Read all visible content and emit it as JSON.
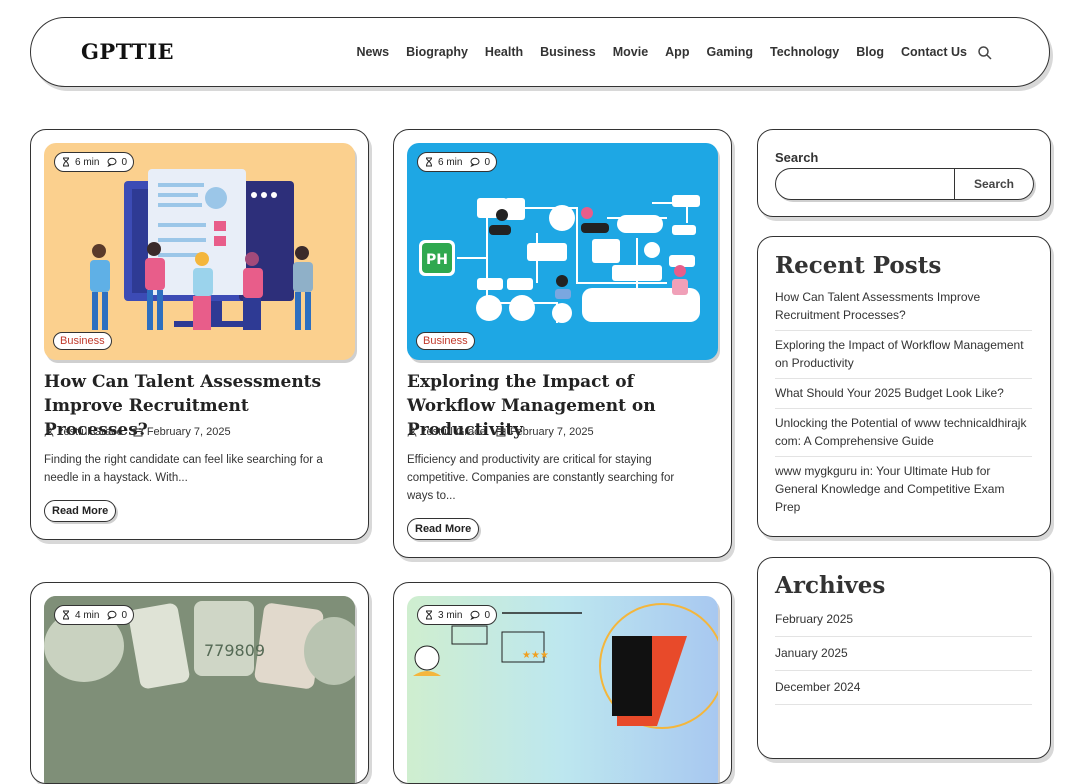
{
  "site": {
    "logo": "GPTTIE"
  },
  "nav": {
    "items": [
      "News",
      "Biography",
      "Health",
      "Business",
      "Movie",
      "App",
      "Gaming",
      "Technology",
      "Blog",
      "Contact Us"
    ]
  },
  "posts": [
    {
      "read_time": "6 min",
      "comments": "0",
      "category": "Business",
      "title": "How Can Talent Assessments Improve Recruitment Processes?",
      "author": "zestful Grace",
      "date": "February 7, 2025",
      "excerpt": "Finding the right candidate can feel like searching for a needle in a haystack. With...",
      "read_more": "Read More"
    },
    {
      "read_time": "6 min",
      "comments": "0",
      "category": "Business",
      "title": "Exploring the Impact of Workflow Management on Productivity",
      "author": "zestful Grace",
      "date": "February 7, 2025",
      "excerpt": "Efficiency and productivity are critical for staying competitive. Companies are constantly searching for ways to...",
      "read_more": "Read More"
    },
    {
      "read_time": "4 min",
      "comments": "0"
    },
    {
      "read_time": "3 min",
      "comments": "0"
    }
  ],
  "sidebar": {
    "search": {
      "label": "Search",
      "button": "Search"
    },
    "recent": {
      "title": "Recent Posts",
      "items": [
        "How Can Talent Assessments Improve Recruitment Processes?",
        "Exploring the Impact of Workflow Management on Productivity",
        "What Should Your 2025 Budget Look Like?",
        "Unlocking the Potential of www technicaldhirajk com: A Comprehensive Guide",
        "www mygkguru in: Your Ultimate Hub for General Knowledge and Competitive Exam Prep"
      ]
    },
    "archives": {
      "title": "Archives",
      "items": [
        "February 2025",
        "January 2025",
        "December 2024"
      ]
    }
  },
  "icons": {
    "search": "search-icon",
    "hourglass": "hourglass-icon",
    "comment": "comment-icon",
    "user": "user-icon",
    "calendar": "calendar-icon"
  },
  "colors": {
    "category": "#c0392b",
    "thumb1_bg": "#fbd08e",
    "thumb2_bg": "#1ea7e4",
    "thumb4_bg": "#bde7ef"
  }
}
